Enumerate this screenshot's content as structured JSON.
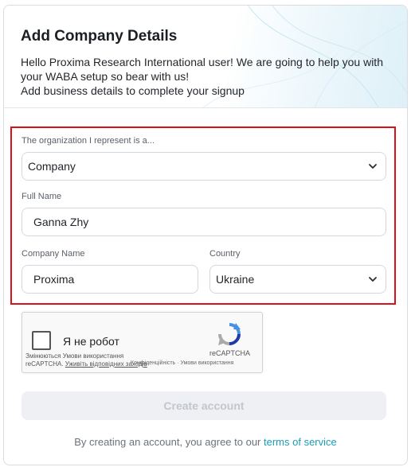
{
  "header": {
    "title": "Add Company Details",
    "intro_line1": "Hello Proxima Research International user! We are going to help you with",
    "intro_line2": "your WABA setup so bear with us!",
    "intro_line3": "Add business details to complete your signup"
  },
  "form": {
    "org_type_label": "The organization I represent is a...",
    "org_type_value": "Company",
    "full_name_label": "Full Name",
    "full_name_value": "Ganna Zhy",
    "company_name_label": "Company Name",
    "company_name_value": "Proxima",
    "country_label": "Country",
    "country_value": "Ukraine",
    "highlight_color": "#d6121b"
  },
  "captcha": {
    "checkbox_label": "Я не робот",
    "brand": "reCAPTCHA",
    "note_line1": "Змінюються Умови використання",
    "note_line2_prefix": "reCAPTCHA. ",
    "note_line2_link": "Уживіть відповідних заходів",
    "privacy_terms": "Конфіденційність · Умови використання"
  },
  "actions": {
    "create_label": "Create account"
  },
  "footer": {
    "terms_prefix": "By creating an account, you agree to our ",
    "terms_link": "terms of service",
    "link_color": "#1b9db7"
  }
}
